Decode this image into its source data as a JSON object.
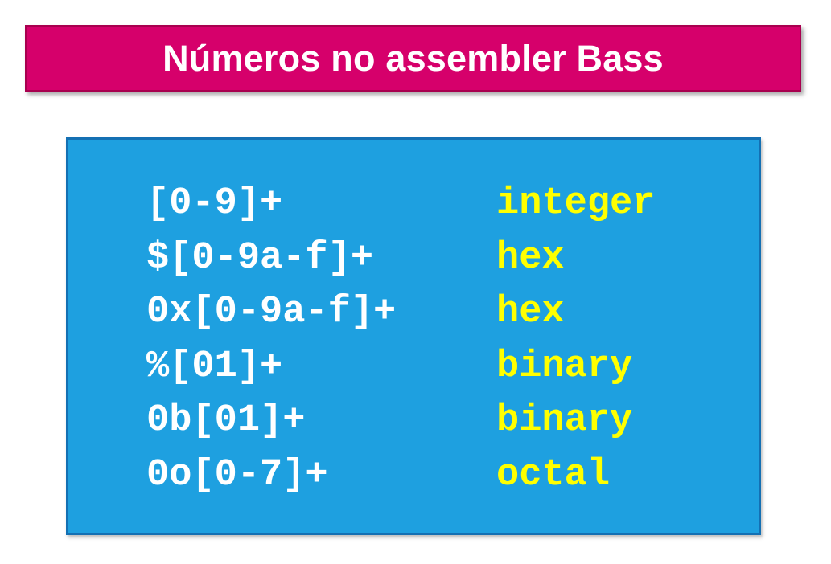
{
  "slide": {
    "title": "Números no assembler Bass"
  },
  "table": {
    "rows": [
      {
        "pattern": "[0-9]+",
        "label": "integer"
      },
      {
        "pattern": "$[0-9a-f]+",
        "label": "hex"
      },
      {
        "pattern": "0x[0-9a-f]+",
        "label": "hex"
      },
      {
        "pattern": "%[01]+",
        "label": "binary"
      },
      {
        "pattern": "0b[01]+",
        "label": "binary"
      },
      {
        "pattern": "0o[0-7]+",
        "label": "octal"
      }
    ]
  },
  "colors": {
    "title_background": "#d6006b",
    "box_background": "#1ea0e0",
    "box_border": "#1470b3",
    "pattern_text": "#ffffff",
    "label_text": "#ffff00"
  }
}
